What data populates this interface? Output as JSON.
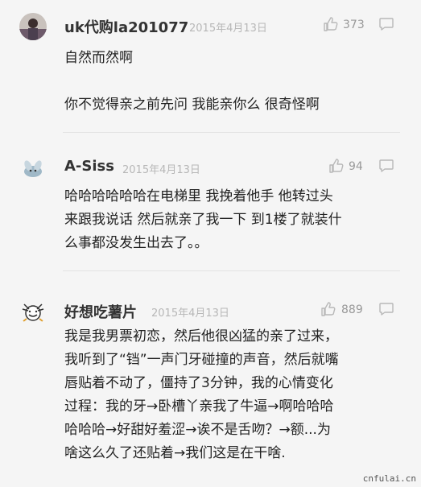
{
  "comments": [
    {
      "username": "uk代购la201077",
      "date": "2015年4月13日",
      "likes": "373",
      "lines": [
        "自然而然啊",
        "",
        "你不觉得亲之前先问 我能亲你么 很奇怪啊"
      ]
    },
    {
      "username": "A-Siss",
      "date": "2015年4月13日",
      "likes": "94",
      "lines": [
        "哈哈哈哈哈哈在电梯里 我挽着他手 他转过头",
        "来跟我说话 然后就亲了我一下 到1楼了就装什",
        "么事都没发生出去了。。"
      ]
    },
    {
      "username": "好想吃薯片",
      "date": "2015年4月13日",
      "likes": "889",
      "lines": [
        "我是我男票初恋，然后他很凶猛的亲了过来，",
        "我听到了“铛”一声门牙碰撞的声音，然后就嘴",
        "唇贴着不动了，僵持了3分钟，我的心情变化",
        "过程：我的牙→卧槽丫亲我了牛逼→啊哈哈哈",
        "哈哈哈→好甜好羞涩→诶不是舌吻？→额...为",
        "啥这么久了还贴着→我们这是在干啥."
      ]
    }
  ],
  "icons": {
    "like": "thumbs-up-icon",
    "reply": "comment-icon"
  },
  "watermark": "cnfulai.cn"
}
